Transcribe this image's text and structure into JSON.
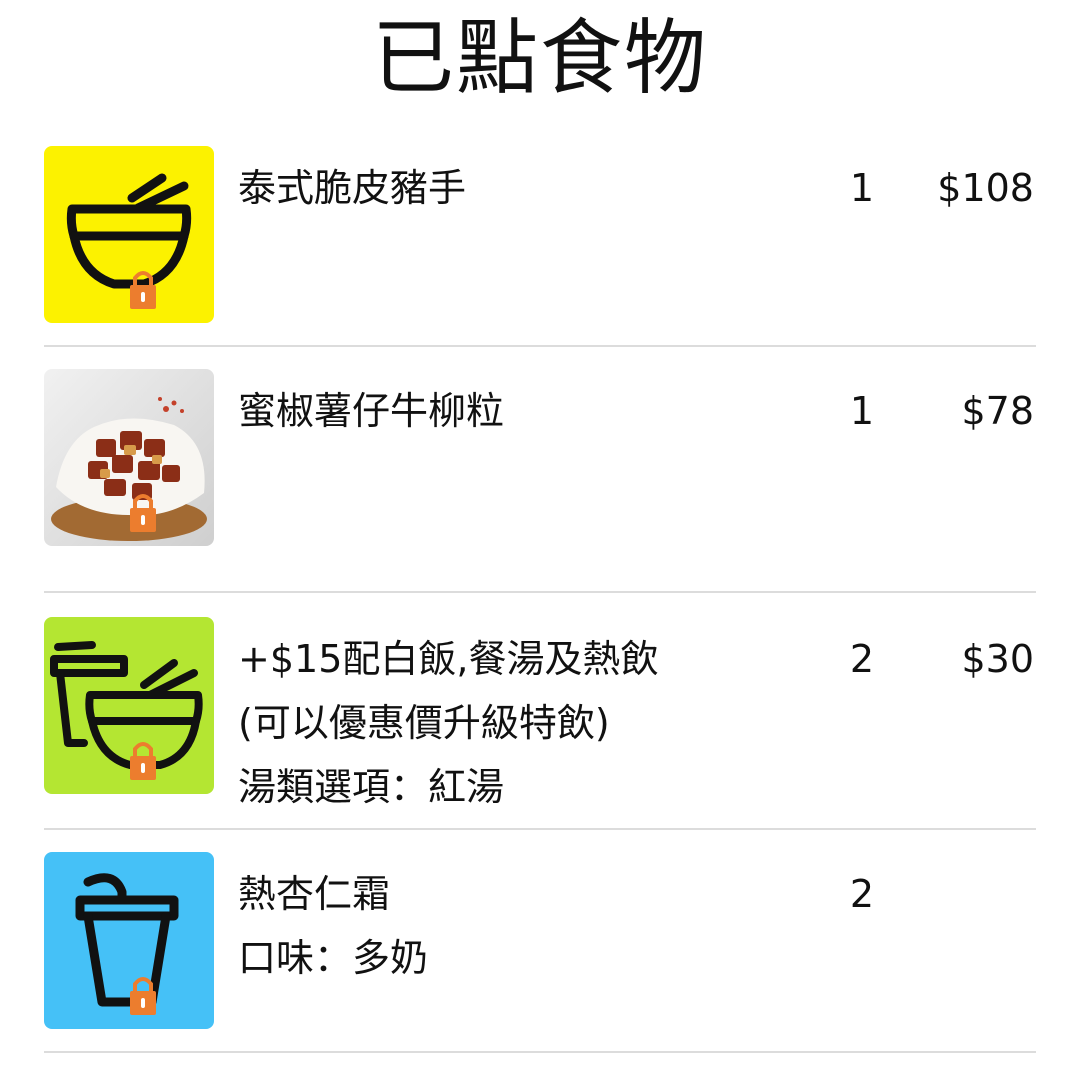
{
  "page": {
    "title": "已點食物"
  },
  "order": {
    "items": [
      {
        "name": "泰式脆皮豬手",
        "qty": "1",
        "price": "$108",
        "icon": "rice-bowl-icon",
        "tile_color": "#fcf200",
        "locked": true
      },
      {
        "name": "蜜椒薯仔牛柳粒",
        "qty": "1",
        "price": "$78",
        "icon": "food-photo",
        "locked": true
      },
      {
        "name": "+$15配白飯,餐湯及熱飲",
        "name_line2": "(可以優惠價升級特飲)",
        "option": "湯類選項：紅湯",
        "qty": "2",
        "price": "$30",
        "icon": "drink-and-bowl-icon",
        "tile_color": "#b4e632",
        "locked": true
      },
      {
        "name": "熱杏仁霜",
        "option": "口味：多奶",
        "qty": "2",
        "price": "",
        "icon": "drink-cup-icon",
        "tile_color": "#45c1f7",
        "locked": true
      }
    ]
  },
  "colors": {
    "lock": "#ec7d2e",
    "divider": "#dcdcdc",
    "text": "#111111"
  }
}
